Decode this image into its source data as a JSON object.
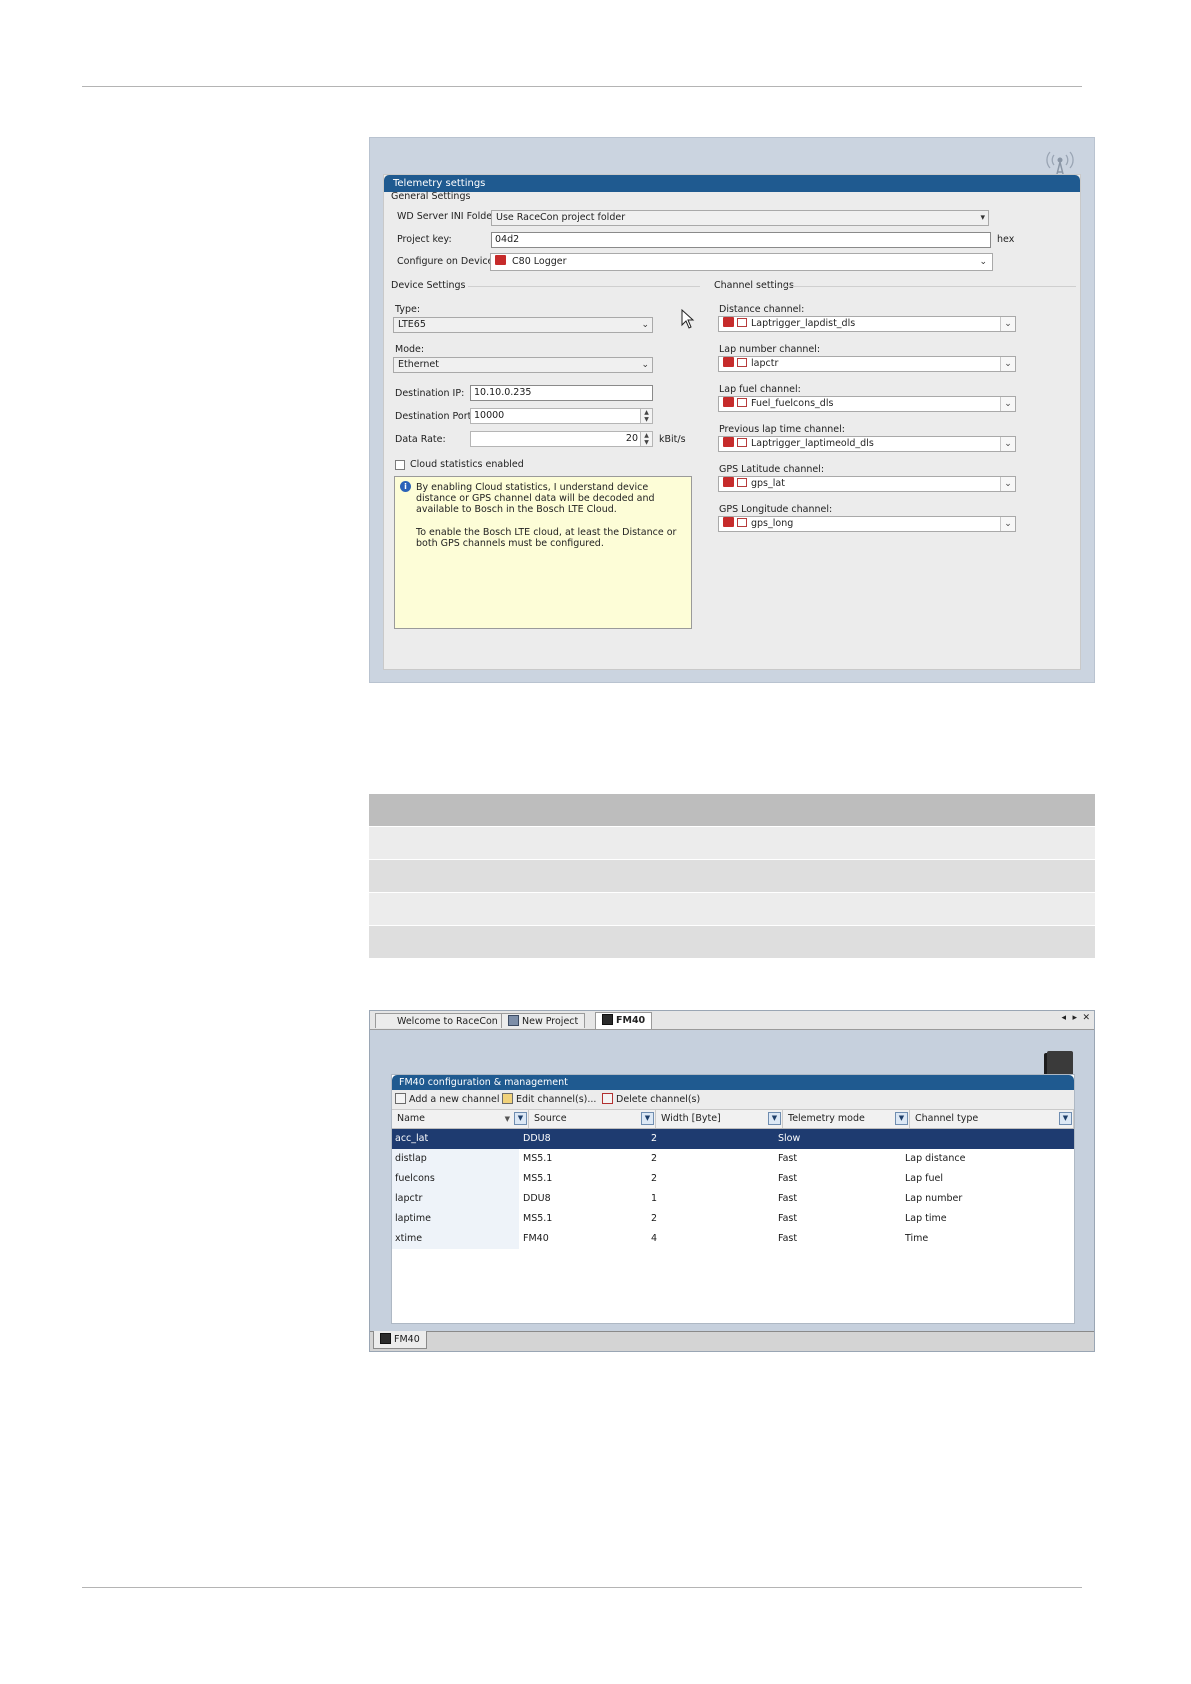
{
  "telemetry": {
    "panel_title": "Telemetry settings",
    "general": {
      "section_label": "General Settings",
      "wd_label": "WD Server INI Folder:",
      "wd_value": "Use RaceCon project folder",
      "project_key_label": "Project key:",
      "project_key_value": "04d2",
      "project_key_unit": "hex",
      "configure_label": "Configure on Device:",
      "configure_value": "C80 Logger"
    },
    "device": {
      "section_label": "Device Settings",
      "type_label": "Type:",
      "type_value": "LTE65",
      "mode_label": "Mode:",
      "mode_value": "Ethernet",
      "dest_ip_label": "Destination IP:",
      "dest_ip_value": "10.10.0.235",
      "dest_port_label": "Destination Port:",
      "dest_port_value": "10000",
      "data_rate_label": "Data Rate:",
      "data_rate_value": "20",
      "data_rate_unit": "kBit/s",
      "cloud_label": "Cloud statistics enabled",
      "info_p1": "By enabling Cloud statistics, I understand device distance or GPS channel data will be decoded and available to Bosch in the Bosch LTE Cloud.",
      "info_p2": "To enable the Bosch LTE cloud, at least the Distance or both GPS channels must be configured."
    },
    "channels": {
      "section_label": "Channel settings",
      "items": [
        {
          "label": "Distance channel:",
          "value": "Laptrigger_lapdist_dls"
        },
        {
          "label": "Lap number channel:",
          "value": "lapctr"
        },
        {
          "label": "Lap fuel channel:",
          "value": "Fuel_fuelcons_dls"
        },
        {
          "label": "Previous lap time channel:",
          "value": "Laptrigger_laptimeold_dls"
        },
        {
          "label": "GPS Latitude channel:",
          "value": "gps_lat"
        },
        {
          "label": "GPS Longitude channel:",
          "value": "gps_long"
        }
      ]
    }
  },
  "fm40": {
    "tabs": [
      "Welcome to RaceCon",
      "New Project",
      "FM40"
    ],
    "panel_title": "FM40 configuration & management",
    "toolbar": {
      "add": "Add a new channel",
      "edit": "Edit channel(s)...",
      "delete": "Delete channel(s)"
    },
    "columns": [
      "Name",
      "Source",
      "Width [Byte]",
      "Telemetry mode",
      "Channel type"
    ],
    "rows": [
      [
        "acc_lat",
        "DDU8",
        "2",
        "Slow",
        ""
      ],
      [
        "distlap",
        "MS5.1",
        "2",
        "Fast",
        "Lap distance"
      ],
      [
        "fuelcons",
        "MS5.1",
        "2",
        "Fast",
        "Lap fuel"
      ],
      [
        "lapctr",
        "DDU8",
        "1",
        "Fast",
        "Lap number"
      ],
      [
        "laptime",
        "MS5.1",
        "2",
        "Fast",
        "Lap time"
      ],
      [
        "xtime",
        "FM40",
        "4",
        "Fast",
        "Time"
      ]
    ],
    "bottom_tab": "FM40"
  },
  "colors": {
    "title_bar": "#1f5a90",
    "selected_row": "#1e3b70",
    "info_background": "#fdfdd7"
  }
}
